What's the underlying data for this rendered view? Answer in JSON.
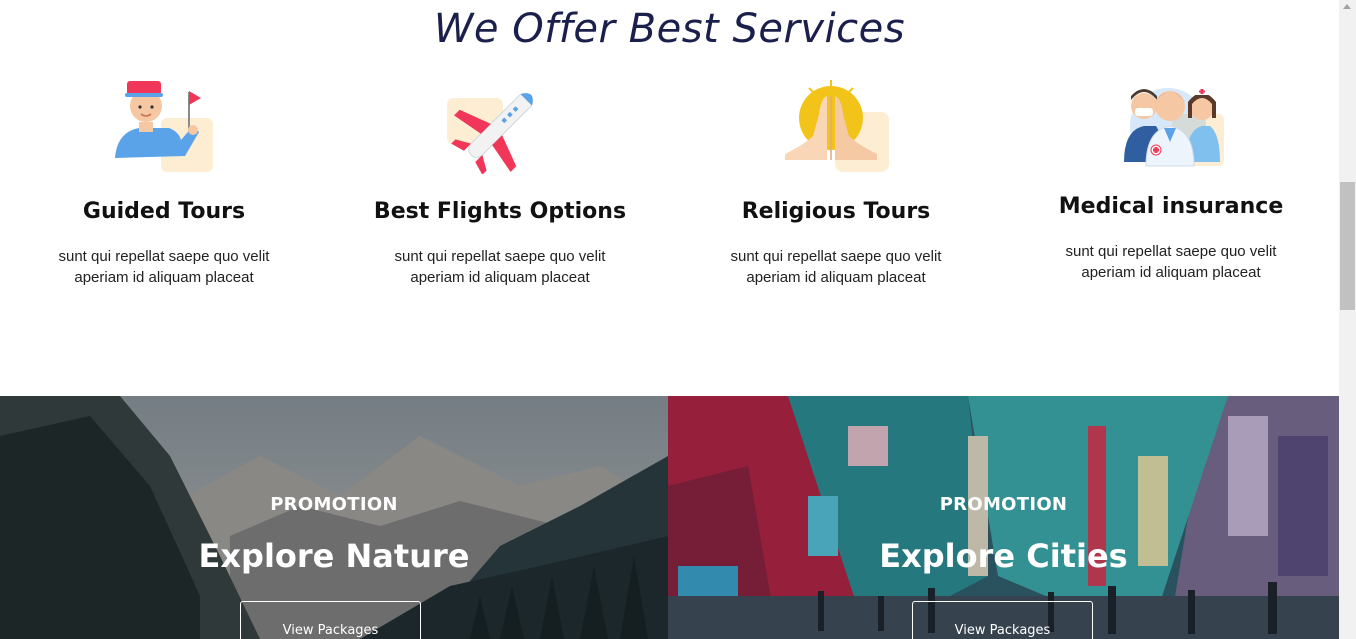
{
  "section": {
    "title": "We Offer Best Services"
  },
  "services": [
    {
      "title": "Guided Tours",
      "line1": "sunt qui repellat saepe quo velit",
      "line2": "aperiam id aliquam placeat",
      "icon": "tour-guide-icon"
    },
    {
      "title": "Best Flights Options",
      "line1": "sunt qui repellat saepe quo velit",
      "line2": "aperiam id aliquam placeat",
      "icon": "airplane-icon"
    },
    {
      "title": "Religious Tours",
      "line1": "sunt qui repellat saepe quo velit",
      "line2": "aperiam id aliquam placeat",
      "icon": "praying-hands-icon"
    },
    {
      "title": "Medical insurance",
      "line1": "sunt qui repellat saepe quo velit",
      "line2": "aperiam id aliquam placeat",
      "icon": "medical-team-icon"
    }
  ],
  "promos": [
    {
      "eyebrow": "PROMOTION",
      "headline": "Explore Nature",
      "button": "View Packages"
    },
    {
      "eyebrow": "PROMOTION",
      "headline": "Explore Cities",
      "button": "View Packages"
    }
  ],
  "colors": {
    "title": "#1b1f4b",
    "accent_red": "#f0375a",
    "accent_blue": "#5aa3e8",
    "icon_bg": "#fdeed3"
  }
}
